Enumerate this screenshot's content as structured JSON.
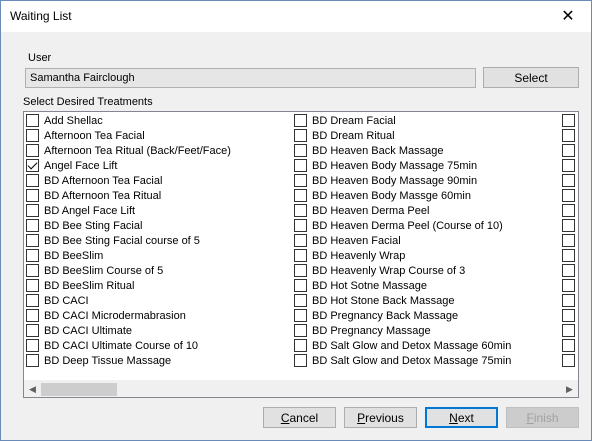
{
  "window": {
    "title": "Waiting List",
    "close_symbol": "✕"
  },
  "user": {
    "label": "User",
    "value": "Samantha Fairclough",
    "select_button": "Select"
  },
  "treatments": {
    "label": "Select Desired Treatments",
    "column1": [
      {
        "label": "Add Shellac",
        "checked": false
      },
      {
        "label": "Afternoon Tea Facial",
        "checked": false
      },
      {
        "label": "Afternoon Tea Ritual (Back/Feet/Face)",
        "checked": false
      },
      {
        "label": "Angel Face Lift",
        "checked": true
      },
      {
        "label": "BD Afternoon Tea Facial",
        "checked": false
      },
      {
        "label": "BD Afternoon Tea Ritual",
        "checked": false
      },
      {
        "label": "BD Angel Face Lift",
        "checked": false
      },
      {
        "label": "BD Bee Sting Facial",
        "checked": false
      },
      {
        "label": "BD Bee Sting Facial course of 5",
        "checked": false
      },
      {
        "label": "BD BeeSlim",
        "checked": false
      },
      {
        "label": "BD BeeSlim Course of 5",
        "checked": false
      },
      {
        "label": "BD BeeSlim Ritual",
        "checked": false
      },
      {
        "label": "BD CACI",
        "checked": false
      },
      {
        "label": "BD CACI Microdermabrasion",
        "checked": false
      },
      {
        "label": "BD CACI Ultimate",
        "checked": false
      },
      {
        "label": "BD CACI Ultimate Course of 10",
        "checked": false
      },
      {
        "label": "BD Deep Tissue Massage",
        "checked": false
      }
    ],
    "column2": [
      {
        "label": "BD Dream Facial",
        "checked": false
      },
      {
        "label": "BD Dream Ritual",
        "checked": false
      },
      {
        "label": "BD Heaven Back Massage",
        "checked": false
      },
      {
        "label": "BD Heaven Body Massage 75min",
        "checked": false
      },
      {
        "label": "BD Heaven Body Massage 90min",
        "checked": false
      },
      {
        "label": "BD Heaven Body Massge 60min",
        "checked": false
      },
      {
        "label": "BD Heaven Derma Peel",
        "checked": false
      },
      {
        "label": "BD Heaven Derma Peel (Course of 10)",
        "checked": false
      },
      {
        "label": "BD Heaven Facial",
        "checked": false
      },
      {
        "label": "BD Heavenly Wrap",
        "checked": false
      },
      {
        "label": "BD Heavenly Wrap Course of 3",
        "checked": false
      },
      {
        "label": "BD Hot Sotne Massage",
        "checked": false
      },
      {
        "label": "BD Hot Stone Back Massage",
        "checked": false
      },
      {
        "label": "BD Pregnancy Back Massage",
        "checked": false
      },
      {
        "label": "BD Pregnancy Massage",
        "checked": false
      },
      {
        "label": "BD Salt Glow and Detox Massage 60min",
        "checked": false
      },
      {
        "label": "BD Salt Glow and Detox Massage 75min",
        "checked": false
      }
    ],
    "column3_count": 17
  },
  "scrollbar": {
    "left_arrow": "◀",
    "right_arrow": "▶"
  },
  "buttons": {
    "cancel": {
      "pre": "",
      "accel": "C",
      "post": "ancel"
    },
    "previous": {
      "pre": "",
      "accel": "P",
      "post": "revious"
    },
    "next": {
      "pre": "",
      "accel": "N",
      "post": "ext"
    },
    "finish": {
      "pre": "",
      "accel": "F",
      "post": "inish"
    }
  }
}
